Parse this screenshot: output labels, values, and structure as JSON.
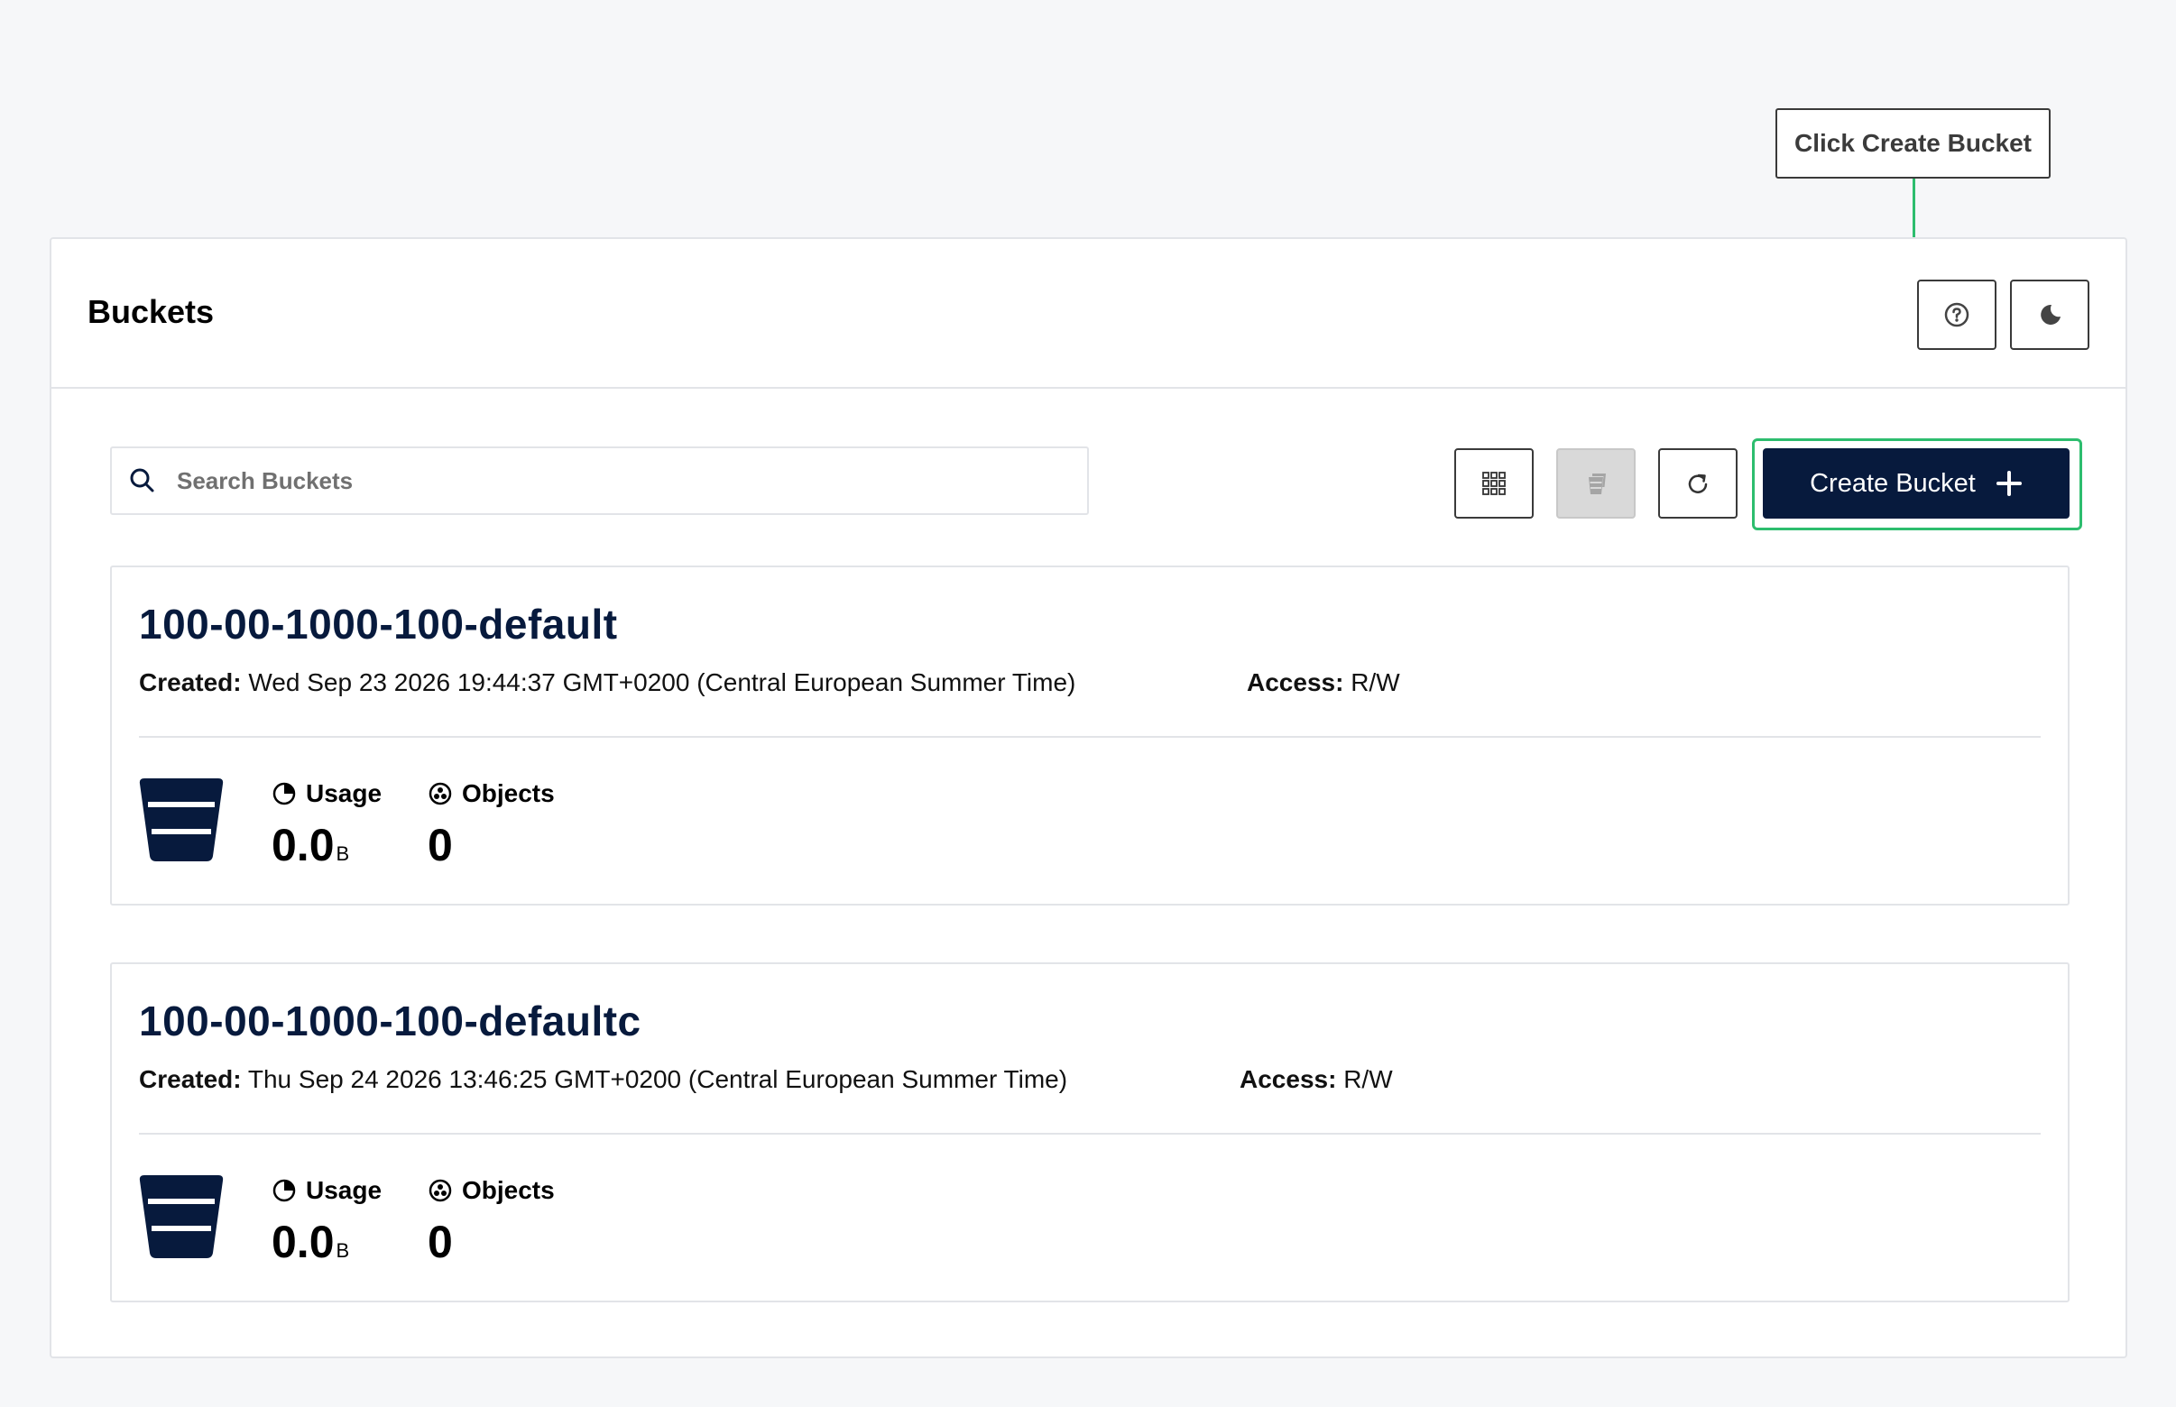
{
  "callout": {
    "text": "Click Create Bucket"
  },
  "header": {
    "title": "Buckets",
    "help_icon": "question-circle-icon",
    "theme_icon": "moon-icon"
  },
  "toolbar": {
    "search_placeholder": "Search Buckets",
    "search_value": "",
    "create_label": "Create Bucket",
    "highlight_color": "#2dbd6e",
    "primary_color": "#071a3d"
  },
  "buckets": [
    {
      "name": "100-00-1000-100-default",
      "created_label": "Created:",
      "created_value": "Wed Sep 23 2026 19:44:37 GMT+0200 (Central European Summer Time)",
      "access_label": "Access:",
      "access_value": "R/W",
      "usage_label": "Usage",
      "usage_value": "0.0",
      "usage_unit": "B",
      "objects_label": "Objects",
      "objects_value": "0"
    },
    {
      "name": "100-00-1000-100-defaultc",
      "created_label": "Created:",
      "created_value": "Thu Sep 24 2026 13:46:25 GMT+0200 (Central European Summer Time)",
      "access_label": "Access:",
      "access_value": "R/W",
      "usage_label": "Usage",
      "usage_value": "0.0",
      "usage_unit": "B",
      "objects_label": "Objects",
      "objects_value": "0"
    }
  ]
}
